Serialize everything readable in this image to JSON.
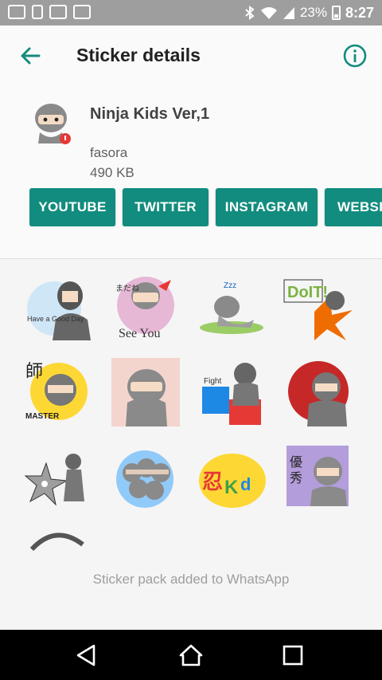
{
  "status_bar": {
    "battery": "23%",
    "time": "8:27"
  },
  "app_bar": {
    "title": "Sticker details"
  },
  "pack": {
    "name": "Ninja Kids Ver,1",
    "author": "fasora",
    "size": "490 KB"
  },
  "links": [
    "YOUTUBE",
    "TWITTER",
    "INSTAGRAM",
    "WEBSITE"
  ],
  "stickers": {
    "s1_text": "Have a Good Day",
    "s2_text": "See You",
    "s4_text": "DoIT!",
    "s5_text": "MASTER",
    "s7_text": "Fight"
  },
  "footer": {
    "added_text": "Sticker pack added to WhatsApp"
  },
  "colors": {
    "accent": "#128c7e",
    "status_bar": "#9e9e9e"
  }
}
